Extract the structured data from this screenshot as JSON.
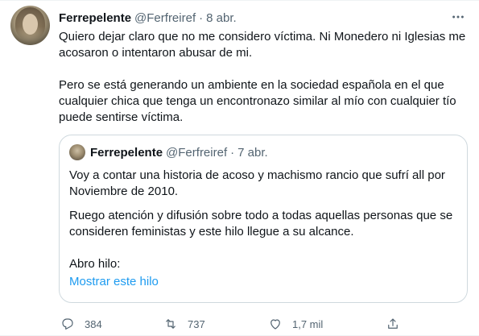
{
  "tweet": {
    "author_name": "Ferrepelente",
    "author_handle": "@Ferfreiref",
    "separator": "·",
    "date": "8 abr.",
    "paragraph1": "Quiero dejar claro que no me considero víctima. Ni Monedero ni Iglesias me acosaron o intentaron abusar de mi.",
    "paragraph2": "Pero se está generando un ambiente en la sociedad española en el que cualquier chica que tenga un encontronazo similar al mío con cualquier tío puede sentirse víctima."
  },
  "quoted_tweet": {
    "author_name": "Ferrepelente",
    "author_handle": "@Ferfreiref",
    "separator": "·",
    "date": "7 abr.",
    "paragraph1": "Voy a contar una historia de acoso y machismo rancio que sufrí all por Noviembre de 2010.",
    "paragraph2": "Ruego atención y difusión sobre todo a todas aquellas personas que se consideren feministas y este hilo llegue a su alcance.",
    "paragraph3": "Abro hilo:",
    "show_thread_link": "Mostrar este hilo"
  },
  "actions": {
    "replies": "384",
    "retweets": "737",
    "likes": "1,7 mil"
  },
  "icons": {
    "more": "more-horizontal-icon",
    "reply": "reply-icon",
    "retweet": "retweet-icon",
    "like": "heart-icon",
    "share": "share-icon"
  },
  "colors": {
    "primary_text": "#0f1419",
    "secondary_text": "#536471",
    "link": "#1d9bf0",
    "border": "#cfd9de"
  }
}
